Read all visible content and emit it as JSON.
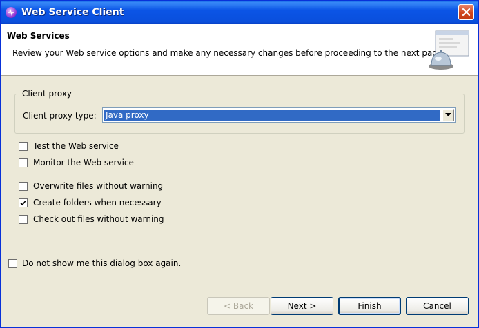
{
  "window": {
    "title": "Web Service Client",
    "icons": {
      "app": "web-service-wizard-icon",
      "close": "close-icon"
    }
  },
  "banner": {
    "title": "Web Services",
    "description": "Review your Web service options and make any necessary changes before proceeding to the next page.",
    "art": "wizard-banner-illustration"
  },
  "client_proxy": {
    "group_label": "Client proxy",
    "type_label": "Client proxy type:",
    "type_value": "Java proxy"
  },
  "options": {
    "test_service": {
      "label": "Test the Web service",
      "checked": false
    },
    "monitor_service": {
      "label": "Monitor the Web service",
      "checked": false
    },
    "overwrite_files": {
      "label": "Overwrite files without warning",
      "checked": false
    },
    "create_folders": {
      "label": "Create folders when necessary",
      "checked": true
    },
    "check_out_files": {
      "label": "Check out files without warning",
      "checked": false
    },
    "do_not_show": {
      "label": "Do not show me this dialog box again.",
      "checked": false
    }
  },
  "buttons": {
    "back": "< Back",
    "next": "Next >",
    "finish": "Finish",
    "cancel": "Cancel"
  },
  "colors": {
    "titlebar": "#0a55e6",
    "selection": "#316ac5",
    "dialog_bg": "#ece9d8"
  }
}
